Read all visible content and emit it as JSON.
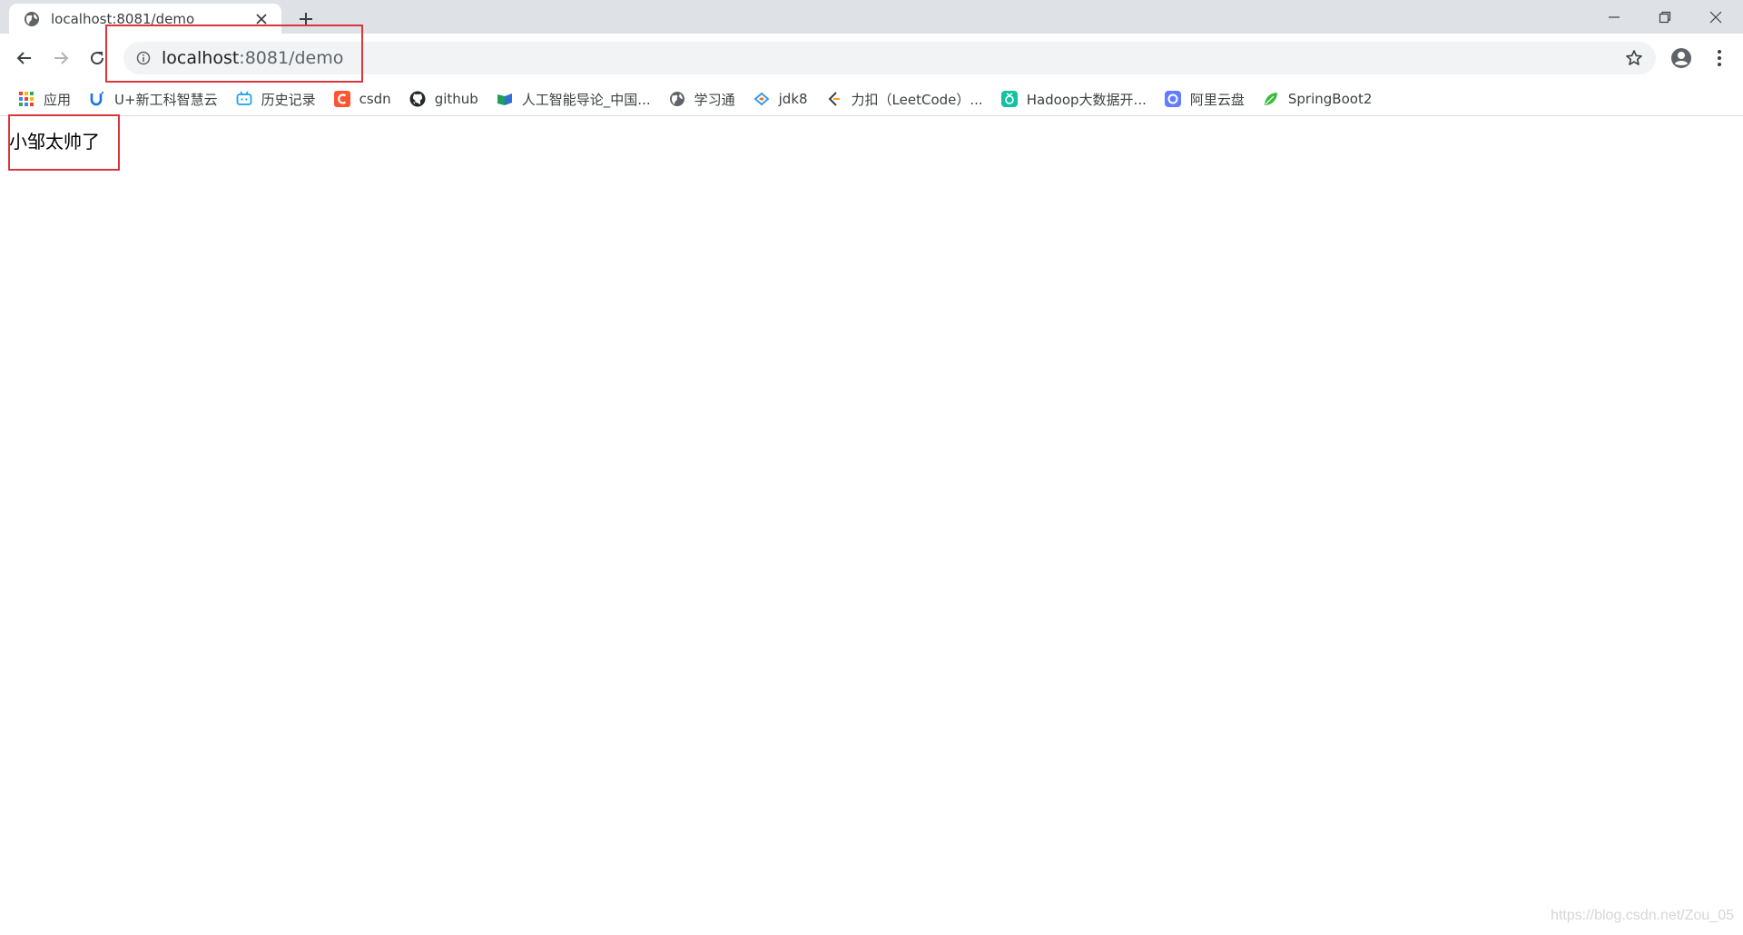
{
  "tab": {
    "title": "localhost:8081/demo",
    "favicon": "globe-icon",
    "close_icon": "close-icon"
  },
  "new_tab_icon": "plus-icon",
  "window_controls": [
    "minimize-icon",
    "restore-icon",
    "close-icon"
  ],
  "toolbar": {
    "back_icon": "arrow-left-icon",
    "forward_icon": "arrow-right-icon",
    "reload_icon": "reload-icon",
    "url_host": "localhost",
    "url_rest": ":8081/demo",
    "site_info_icon": "info-icon",
    "bookmark_icon": "star-icon",
    "profile_icon": "account-icon",
    "menu_icon": "kebab-icon"
  },
  "bookmarks": [
    {
      "label": "应用",
      "icon": "apps-grid-icon",
      "color": "#ea4335"
    },
    {
      "label": "U+新工科智慧云",
      "icon": "u-logo-icon",
      "color": "#1a73e8"
    },
    {
      "label": "历史记录",
      "icon": "bilibili-tv-icon",
      "color": "#1aa3e8"
    },
    {
      "label": "csdn",
      "icon": "csdn-logo-icon",
      "color": "#fc5531"
    },
    {
      "label": "github",
      "icon": "github-icon",
      "color": "#24292e"
    },
    {
      "label": "人工智能导论_中国...",
      "icon": "book-icon",
      "color": "#1e9e5a"
    },
    {
      "label": "学习通",
      "icon": "globe-icon",
      "color": "#5f6368"
    },
    {
      "label": "jdk8",
      "icon": "java-icon",
      "color": "#3d9be9"
    },
    {
      "label": "力扣（LeetCode）...",
      "icon": "leetcode-icon",
      "color": "#ffa116"
    },
    {
      "label": "Hadoop大数据开...",
      "icon": "green-app-icon",
      "color": "#13c2a0"
    },
    {
      "label": "阿里云盘",
      "icon": "aliyun-drive-icon",
      "color": "#637dff"
    },
    {
      "label": "SpringBoot2",
      "icon": "leaf-icon",
      "color": "#3dbb3d"
    }
  ],
  "content": {
    "text": "小邹太帅了"
  },
  "watermark": "https://blog.csdn.net/Zou_05"
}
